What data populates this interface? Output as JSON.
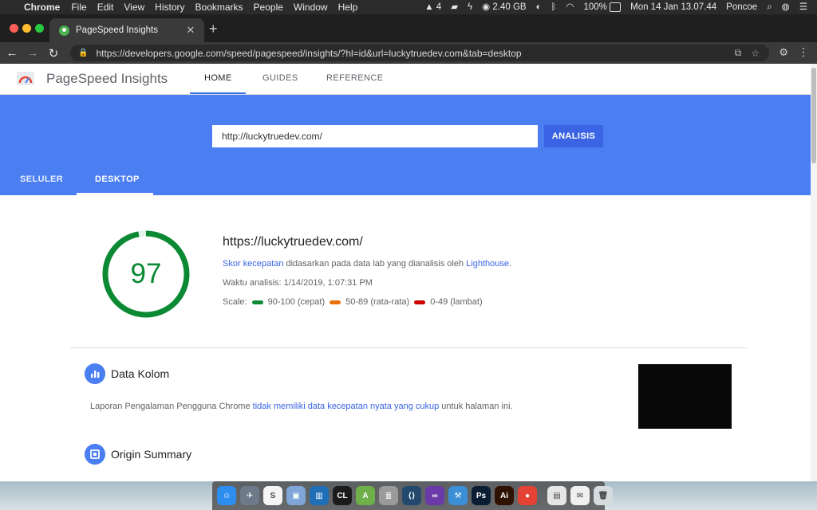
{
  "menubar": {
    "app_name": "Chrome",
    "menus": [
      "File",
      "Edit",
      "View",
      "History",
      "Bookmarks",
      "People",
      "Window",
      "Help"
    ],
    "status": {
      "adobe_count": "4",
      "memory": "2.40 GB",
      "battery": "100%",
      "datetime": "Mon 14 Jan  13.07.44",
      "user": "Poncoe"
    }
  },
  "browser": {
    "tab_title": "PageSpeed Insights",
    "url": "https://developers.google.com/speed/pagespeed/insights/?hl=id&url=luckytruedev.com&tab=desktop"
  },
  "psi": {
    "brand": "PageSpeed Insights",
    "nav": [
      "HOME",
      "GUIDES",
      "REFERENCE"
    ],
    "input_value": "http://luckytruedev.com/",
    "analyze_label": "ANALISIS",
    "tabs": [
      "SELULER",
      "DESKTOP"
    ],
    "score": {
      "value": "97",
      "fraction": 0.97,
      "color": "#0c8a33",
      "url": "https://luckytruedev.com/",
      "desc_link1": "Skor kecepatan",
      "desc_mid": " didasarkan pada data lab yang dianalisis oleh ",
      "desc_link2": "Lighthouse",
      "desc_end": ".",
      "time": "Waktu analisis: 1/14/2019, 1:07:31 PM",
      "scale_label": "Scale:",
      "scale": [
        {
          "label": "90-100 (cepat)",
          "color": "#0c8a33"
        },
        {
          "label": "50-89 (rata-rata)",
          "color": "#e8710a"
        },
        {
          "label": "0-49 (lambat)",
          "color": "#cc0000"
        }
      ]
    },
    "field": {
      "title": "Data Kolom",
      "desc_start": "Laporan Pengalaman Pengguna Chrome ",
      "desc_link": "tidak memiliki data kecepatan nyata yang cukup",
      "desc_end": " untuk halaman ini."
    },
    "origin": {
      "title": "Origin Summary"
    }
  },
  "dock": {
    "apps": [
      {
        "icon": "finder-icon",
        "color": "#2d8ef0",
        "glyph": "☺"
      },
      {
        "icon": "launchpad-icon",
        "color": "#6c7a89",
        "glyph": "✈"
      },
      {
        "icon": "sublime-text-icon",
        "color": "#f5f5f5",
        "glyph": "S"
      },
      {
        "icon": "virtualbox-icon",
        "color": "#7fa6d6",
        "glyph": "▣"
      },
      {
        "icon": "trello-icon",
        "color": "#1e6fb8",
        "glyph": "▥"
      },
      {
        "icon": "clion-icon",
        "color": "#1b1b1b",
        "glyph": "CL"
      },
      {
        "icon": "android-studio-icon",
        "color": "#6fb04b",
        "glyph": "A"
      },
      {
        "icon": "database-icon",
        "color": "#9a9a9a",
        "glyph": "≣"
      },
      {
        "icon": "vscode-icon",
        "color": "#23496f",
        "glyph": "⟨⟩"
      },
      {
        "icon": "visual-studio-icon",
        "color": "#6b3aa8",
        "glyph": "∞"
      },
      {
        "icon": "xcode-icon",
        "color": "#3b8fd6",
        "glyph": "⚒"
      },
      {
        "icon": "photoshop-icon",
        "color": "#0b1d33",
        "glyph": "Ps"
      },
      {
        "icon": "illustrator-icon",
        "color": "#2f1200",
        "glyph": "Ai"
      },
      {
        "icon": "chrome-icon",
        "color": "#e34234",
        "glyph": "●"
      },
      {
        "icon": "preview-icon",
        "color": "#e6e6e6",
        "glyph": "▤"
      },
      {
        "icon": "mail-icon",
        "color": "#f0f0f0",
        "glyph": "✉"
      },
      {
        "icon": "trash-icon",
        "color": "#d6dbe0",
        "glyph": "🗑"
      }
    ]
  }
}
